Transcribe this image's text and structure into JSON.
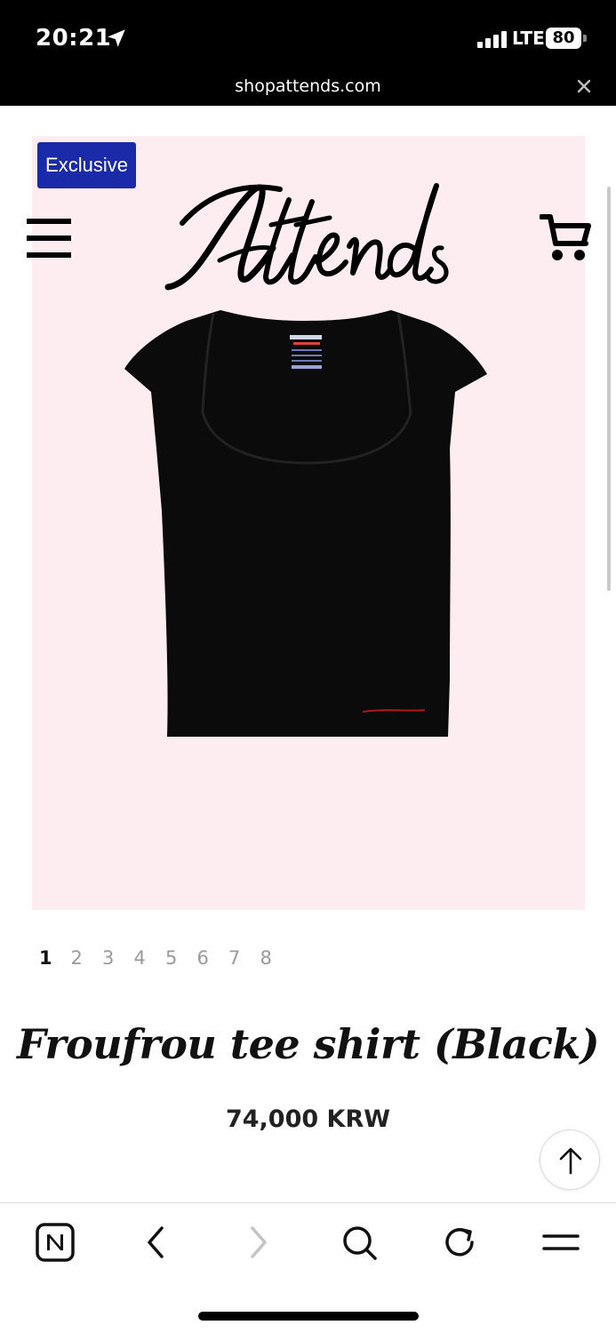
{
  "status_bar": {
    "time": "20:21",
    "network": "LTE",
    "battery": "80"
  },
  "browser": {
    "url": "shopattends.com"
  },
  "product": {
    "badge": "Exclusive",
    "logo_text": "Attends",
    "title": "Froufrou tee shirt (Black)",
    "price": "74,000 KRW",
    "image_pages": [
      "1",
      "2",
      "3",
      "4",
      "5",
      "6",
      "7",
      "8"
    ],
    "current_page": "1",
    "background_color": "#fdedf0",
    "badge_color": "#1a2aa8"
  },
  "icons": {
    "menu": "hamburger-icon",
    "cart": "cart-icon",
    "scroll_top": "arrow-up-icon",
    "toolbar": [
      "naver-home-icon",
      "back-icon",
      "forward-icon",
      "search-icon",
      "reload-icon",
      "menu-icon"
    ]
  }
}
